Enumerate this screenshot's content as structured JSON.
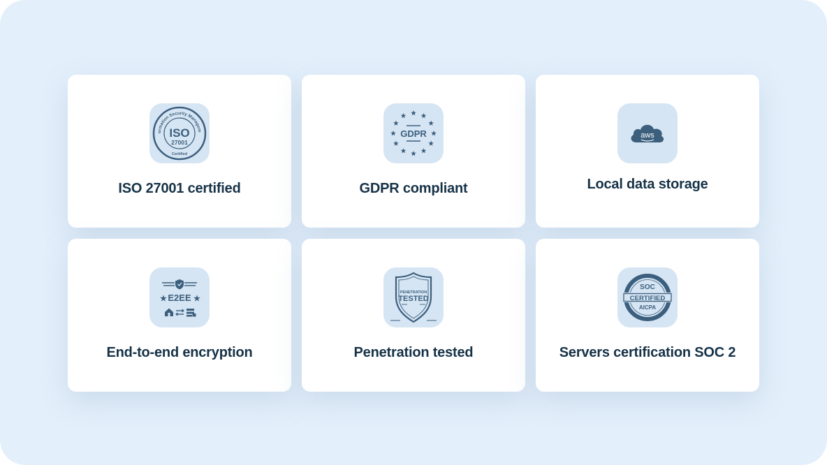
{
  "colors": {
    "background": "#e3effb",
    "card": "#ffffff",
    "icon_tile": "#d6e5f3",
    "icon_ink": "#3c5f7e",
    "label_text": "#163247"
  },
  "cards": [
    {
      "icon": "iso-27001-badge-icon",
      "label": "ISO 27001 certified",
      "badge": {
        "ring_text": "Information Security Management",
        "main": "ISO",
        "number": "27001",
        "bottom": "Certified"
      }
    },
    {
      "icon": "gdpr-stars-icon",
      "label": "GDPR compliant",
      "badge": {
        "main": "GDPR"
      }
    },
    {
      "icon": "aws-cloud-icon",
      "label": "Local data storage",
      "badge": {
        "main": "aws"
      }
    },
    {
      "icon": "e2ee-encryption-icon",
      "label": "End-to-end encryption",
      "badge": {
        "main": "E2EE"
      }
    },
    {
      "icon": "penetration-tested-shield-icon",
      "label": "Penetration tested",
      "badge": {
        "top": "PENETRATION",
        "main": "TESTED"
      }
    },
    {
      "icon": "soc-certified-seal-icon",
      "label": "Servers certification SOC 2",
      "badge": {
        "top": "SOC",
        "main": "CERTIFIED",
        "bottom": "AICPA"
      }
    }
  ]
}
